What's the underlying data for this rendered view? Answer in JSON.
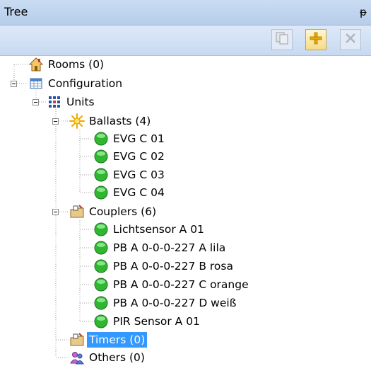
{
  "panel": {
    "title": "Tree",
    "pin_glyph": "ᵽ"
  },
  "toolbar": {
    "buttons": [
      {
        "icon": "copy-icon",
        "enabled": false
      },
      {
        "icon": "add-icon",
        "enabled": true
      },
      {
        "icon": "delete-icon",
        "enabled": false
      }
    ]
  },
  "tree": {
    "rooms": {
      "label": "Rooms (0)",
      "icon": "house-icon"
    },
    "configuration": {
      "label": "Configuration",
      "icon": "table-icon"
    },
    "units": {
      "label": "Units",
      "icon": "network-icon"
    },
    "ballasts": {
      "label": "Ballasts (4)",
      "icon": "light-burst-icon",
      "items": [
        "EVG C 01",
        "EVG C 02",
        "EVG C 03",
        "EVG C 04"
      ]
    },
    "couplers": {
      "label": "Couplers (6)",
      "icon": "folder-plug-icon",
      "items": [
        "Lichtsensor A 01",
        "PB A 0-0-0-227 A lila",
        "PB A 0-0-0-227 B rosa",
        "PB A 0-0-0-227 C orange",
        "PB A 0-0-0-227 D weiß",
        "PIR Sensor A 01"
      ]
    },
    "timers": {
      "label": "Timers (0)",
      "icon": "folder-plug-icon",
      "selected": true
    },
    "others": {
      "label": "Others (0)",
      "icon": "users-icon"
    }
  },
  "colors": {
    "status_ok": "#2fb82f",
    "selection": "#3399ff"
  }
}
